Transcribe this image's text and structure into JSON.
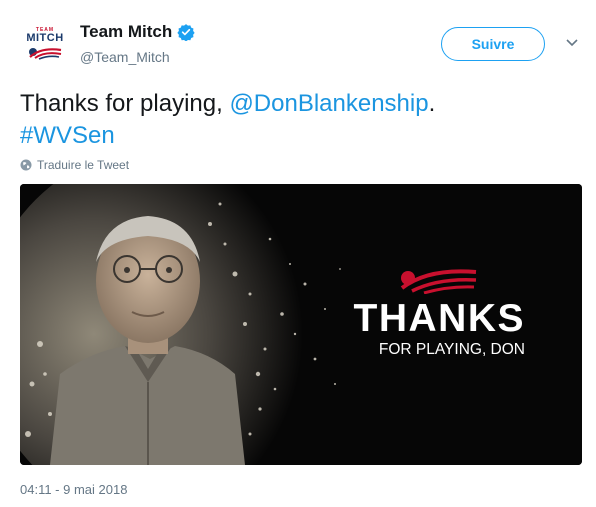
{
  "account": {
    "name": "Team Mitch",
    "handle": "@Team_Mitch",
    "avatar_top": "TEAM",
    "avatar_main": "MITCH"
  },
  "follow_label": "Suivre",
  "tweet": {
    "text_1": "Thanks for playing, ",
    "mention": "@DonBlankenship",
    "text_2": ".",
    "hashtag": "#WVSen"
  },
  "translate_label": "Traduire le Tweet",
  "media": {
    "headline": "THANKS",
    "subline": "FOR PLAYING, DON"
  },
  "timestamp": "04:11 - 9 mai 2018",
  "colors": {
    "link": "#1b95e0",
    "brand_blue": "#1da1f2",
    "accent_red": "#c8102e"
  },
  "icons": [
    "verified-badge-icon",
    "chevron-down-icon",
    "globe-icon"
  ]
}
